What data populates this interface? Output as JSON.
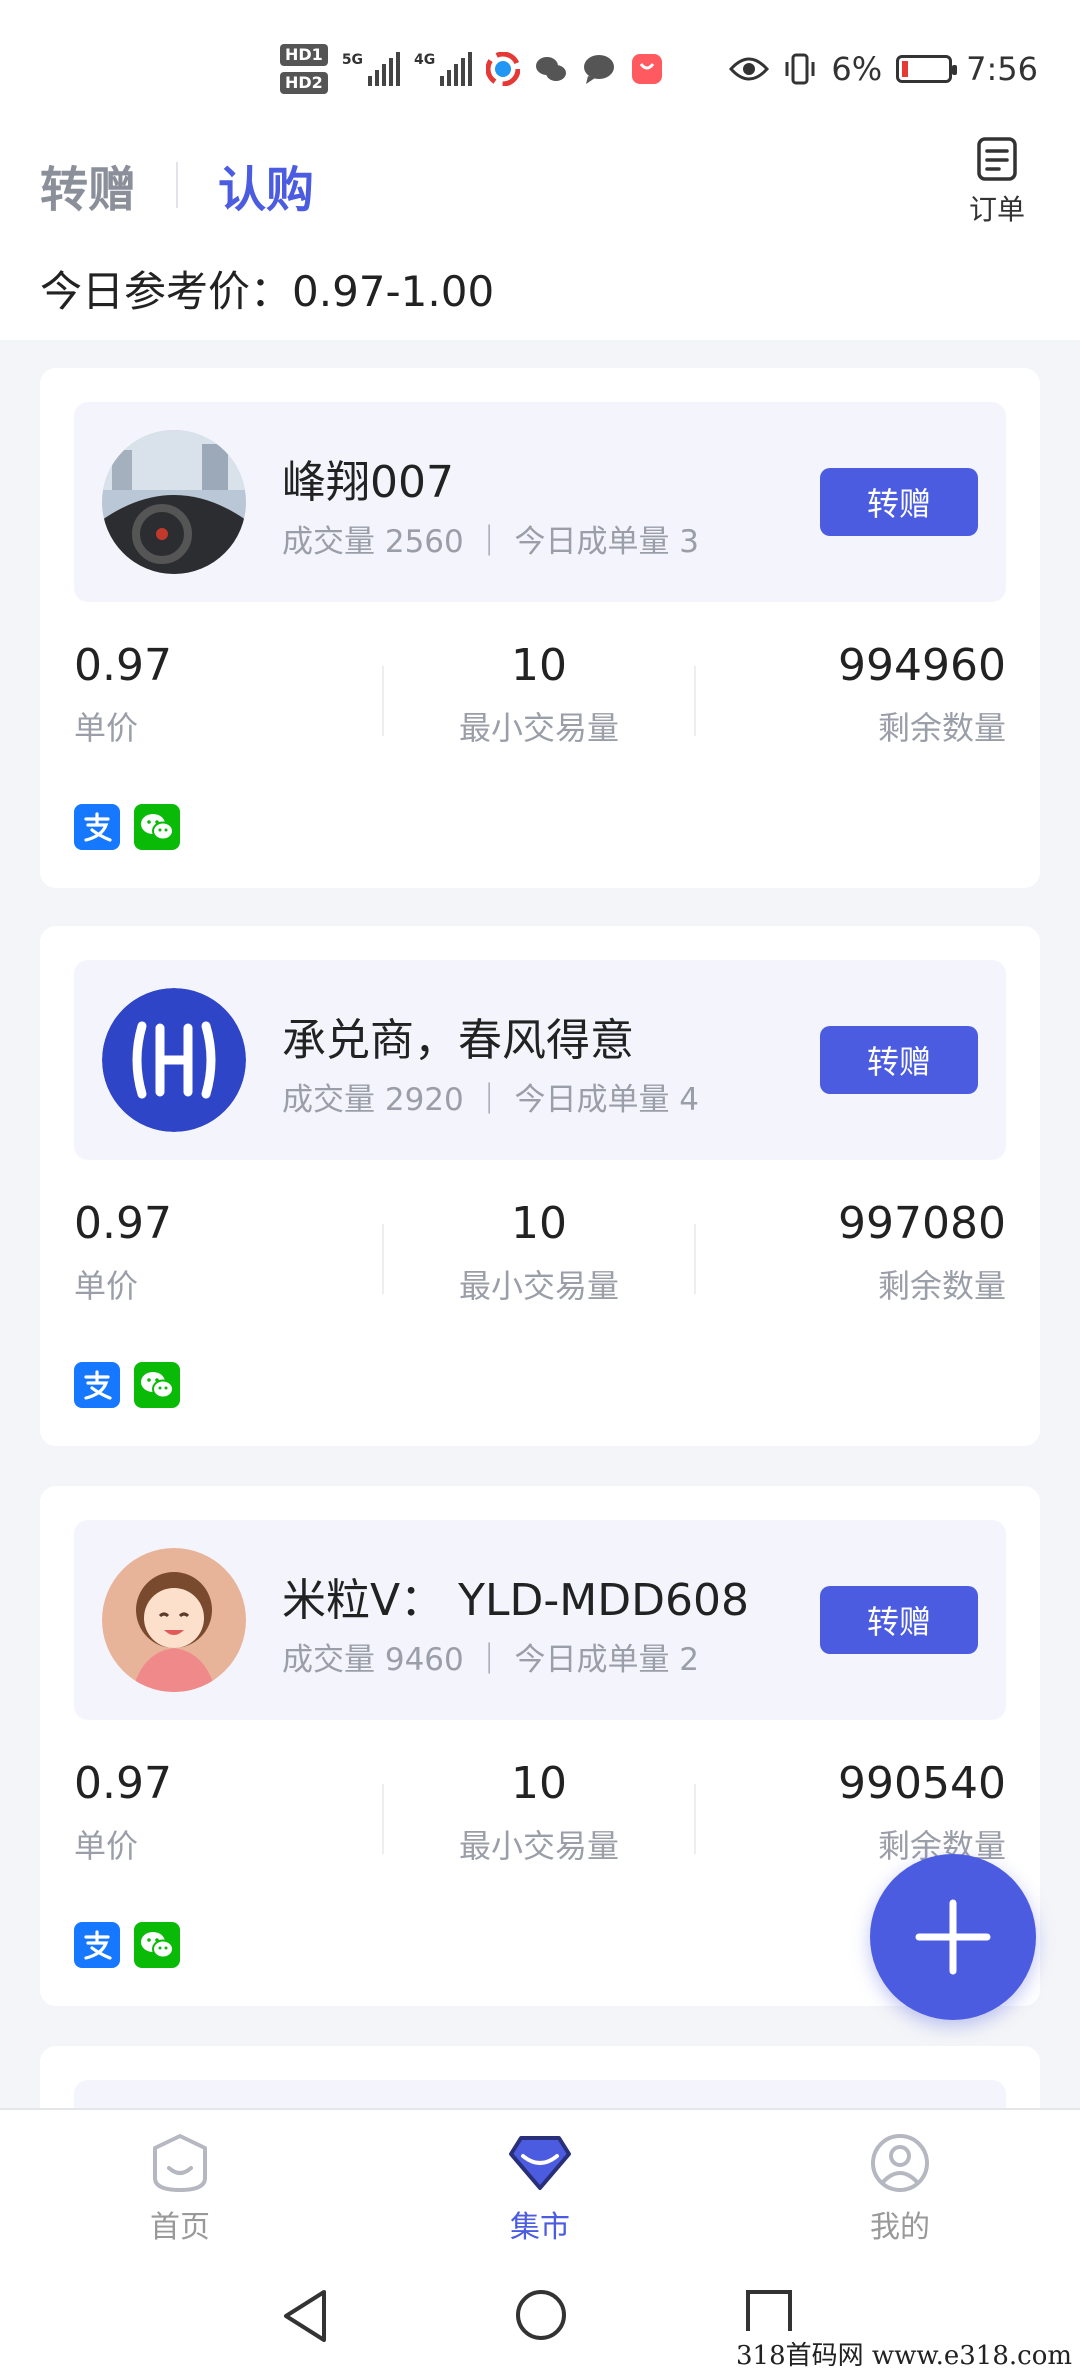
{
  "status_bar": {
    "hd1": "HD1",
    "hd2": "HD2",
    "sim1_label": "5G",
    "sim2_label": "4G",
    "battery_percent": "6%",
    "time": "7:56"
  },
  "header": {
    "tabs": [
      {
        "label": "转赠",
        "active": false
      },
      {
        "label": "认购",
        "active": true
      }
    ],
    "orders_label": "订单",
    "reference_price": "今日参考价：0.97-1.00"
  },
  "cards": [
    {
      "seller_name": "峰翔007",
      "stats": "成交量 2560 ｜ 今日成单量 3",
      "button": "转赠",
      "price": "0.97",
      "price_label": "单价",
      "min_qty": "10",
      "min_qty_label": "最小交易量",
      "remaining": "994960",
      "remaining_label": "剩余数量",
      "payments": [
        "alipay-icon",
        "wechat-pay-icon"
      ]
    },
    {
      "seller_name": "承兑商，春风得意",
      "stats": "成交量 2920 ｜ 今日成单量 4",
      "button": "转赠",
      "price": "0.97",
      "price_label": "单价",
      "min_qty": "10",
      "min_qty_label": "最小交易量",
      "remaining": "997080",
      "remaining_label": "剩余数量",
      "payments": [
        "alipay-icon",
        "wechat-pay-icon"
      ]
    },
    {
      "seller_name": "米粒V： YLD-MDD608",
      "stats": "成交量 9460 ｜ 今日成单量 2",
      "button": "转赠",
      "price": "0.97",
      "price_label": "单价",
      "min_qty": "10",
      "min_qty_label": "最小交易量",
      "remaining": "990540",
      "remaining_label": "剩余数量",
      "payments": [
        "alipay-icon",
        "wechat-pay-icon"
      ]
    }
  ],
  "bottom_nav": [
    {
      "label": "首页",
      "icon": "home-face-icon",
      "active": false
    },
    {
      "label": "集市",
      "icon": "market-gem-icon",
      "active": true
    },
    {
      "label": "我的",
      "icon": "profile-icon",
      "active": false
    }
  ],
  "accent_color": "#4c5ce0",
  "watermark": "318首码网  www.e318.com"
}
